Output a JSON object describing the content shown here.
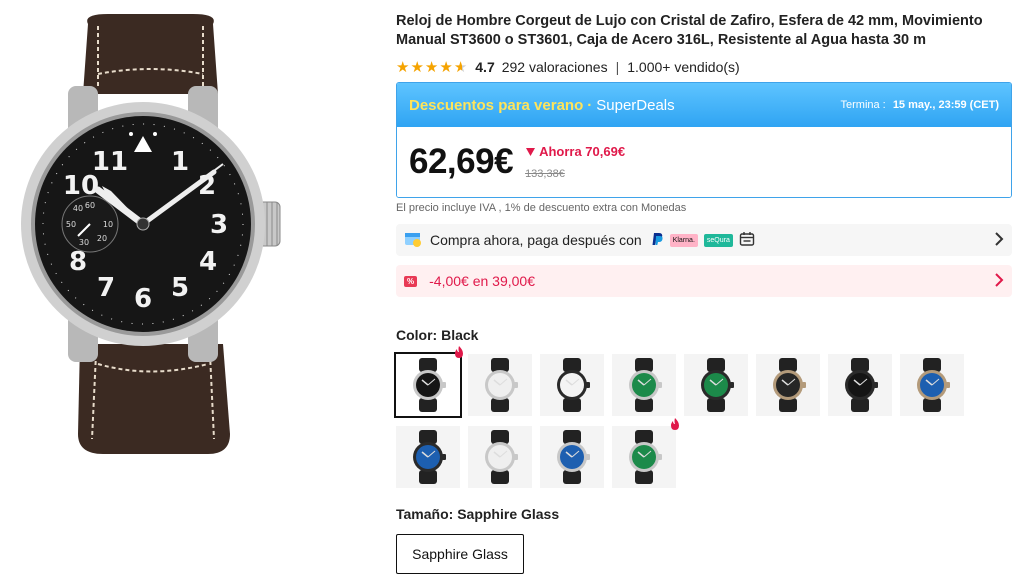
{
  "product": {
    "title": "Reloj de Hombre Corgeut de Lujo con Cristal de Zafiro, Esfera de 42 mm, Movimiento Manual ST3600 o ST3601, Caja de Acero 316L, Resistente al Agua hasta 30 m",
    "rating": "4.7",
    "reviews": "292 valoraciones",
    "separator": "|",
    "sold": "1.000+ vendido(s)"
  },
  "deal": {
    "promo_label": "Descuentos para verano",
    "dot": "·",
    "brand": "SuperDeals",
    "ends_label": "Termina :",
    "ends_date": "15 may., 23:59 (CET)",
    "price": "62,69€",
    "saving": "Ahorra 70,69€",
    "old_price": "133,38€"
  },
  "tax_note": "El precio incluye IVA , 1% de descuento extra con Monedas",
  "pay_later": {
    "label": "Compra ahora, paga después con",
    "klarna": "Klarna.",
    "sequra": "seQura"
  },
  "coupon": {
    "tag": "%",
    "text": "-4,00€ en 39,00€"
  },
  "color": {
    "label": "Color:",
    "value": "Black",
    "swatches": [
      {
        "dial": "#151515",
        "case": "#c8c8c8",
        "selected": true,
        "hot": true
      },
      {
        "dial": "#efefef",
        "case": "#c8c8c8"
      },
      {
        "dial": "#f4f4f4",
        "case": "#2a2a2a"
      },
      {
        "dial": "#1c8a4a",
        "case": "#c8c8c8"
      },
      {
        "dial": "#1c8a4a",
        "case": "#2a2a2a"
      },
      {
        "dial": "#262626",
        "case": "#b39a7a"
      },
      {
        "dial": "#151515",
        "case": "#2a2a2a"
      },
      {
        "dial": "#1d5fb0",
        "case": "#b39a7a"
      },
      {
        "dial": "#1d5fb0",
        "case": "#2a2a2a"
      },
      {
        "dial": "#efefef",
        "case": "#c8c8c8"
      },
      {
        "dial": "#1d5fb0",
        "case": "#c8c8c8"
      },
      {
        "dial": "#1c8a4a",
        "case": "#c8c8c8",
        "hot": true
      }
    ]
  },
  "size": {
    "label": "Tamaño:",
    "value": "Sapphire Glass",
    "option": "Sapphire Glass"
  },
  "colors": {
    "accent_blue": "#2fa4f3",
    "promo_yellow": "#ffe45a",
    "sale_red": "#e0194a",
    "star": "#f5a300"
  }
}
